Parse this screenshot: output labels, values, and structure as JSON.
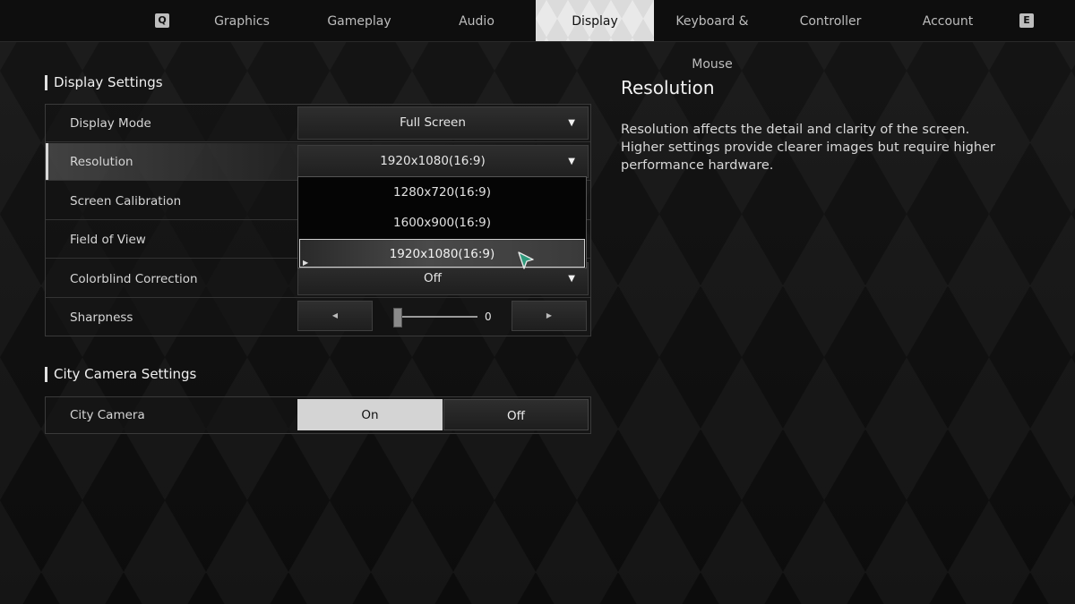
{
  "tabs": {
    "prev_key": "Q",
    "next_key": "E",
    "items": [
      {
        "label": "Graphics"
      },
      {
        "label": "Gameplay"
      },
      {
        "label": "Audio"
      },
      {
        "label": "Display",
        "active": true
      },
      {
        "label": "Keyboard & Mouse"
      },
      {
        "label": "Controller"
      },
      {
        "label": "Account"
      }
    ]
  },
  "display_settings": {
    "title": "Display Settings",
    "rows": [
      {
        "label": "Display Mode",
        "value": "Full Screen"
      },
      {
        "label": "Resolution",
        "value": "1920x1080(16:9)",
        "selected": true
      },
      {
        "label": "Screen Calibration"
      },
      {
        "label": "Field of View"
      },
      {
        "label": "Colorblind Correction",
        "value": "Off"
      },
      {
        "label": "Sharpness",
        "value": "0",
        "slider_level": 0
      }
    ]
  },
  "resolution_dropdown": {
    "options": [
      "1280x720(16:9)",
      "1600x900(16:9)",
      "1920x1080(16:9)"
    ],
    "selected_index": 2
  },
  "city_camera_settings": {
    "title": "City Camera Settings",
    "row": {
      "label": "City Camera",
      "on_label": "On",
      "off_label": "Off",
      "value": "On"
    }
  },
  "description": {
    "title": "Resolution",
    "line1": "Resolution affects the detail and clarity of the screen.",
    "line2": "Higher settings provide clearer images but require higher performance hardware."
  },
  "colors": {
    "accent_active_tab": "#e9e9e9",
    "cursor_fill": "#2f9a7c"
  }
}
